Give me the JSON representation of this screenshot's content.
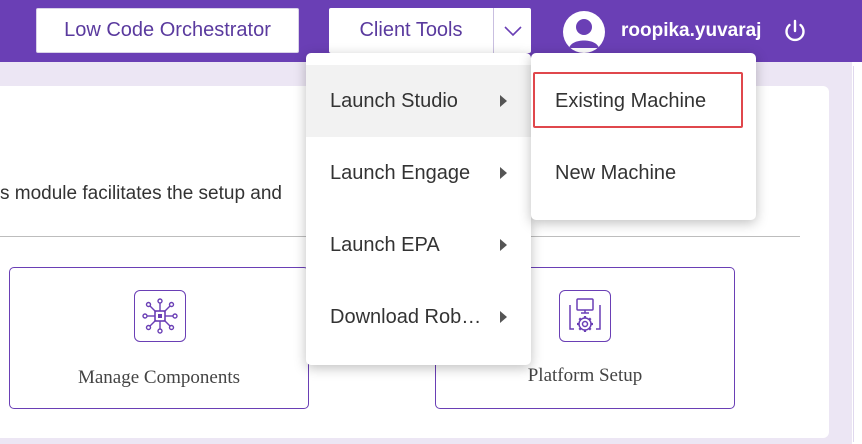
{
  "header": {
    "low_code_orchestrator_label": "Low Code Orchestrator",
    "client_tools_label": "Client Tools",
    "username": "roopika.yuvaraj",
    "icons": {
      "dropdown": "chevron-down-icon",
      "avatar": "user-avatar-icon",
      "power": "power-icon"
    },
    "colors": {
      "brand": "#6a3fb5",
      "background": "#ece6f4",
      "highlight": "#e0474c"
    }
  },
  "main": {
    "description_fragment": "s module facilitates the setup and",
    "tiles": [
      {
        "label": "Manage Components",
        "icon": "components-icon"
      },
      {
        "label": "Platform Setup",
        "icon": "platform-setup-icon"
      }
    ]
  },
  "client_tools_menu": {
    "items": [
      {
        "label": "Launch Studio",
        "active": true
      },
      {
        "label": "Launch Engage",
        "active": false
      },
      {
        "label": "Launch EPA",
        "active": false
      },
      {
        "label": "Download Rob…",
        "active": false
      }
    ]
  },
  "launch_studio_submenu": {
    "items": [
      {
        "label": "Existing Machine",
        "highlighted": true
      },
      {
        "label": "New Machine",
        "highlighted": false
      }
    ]
  }
}
